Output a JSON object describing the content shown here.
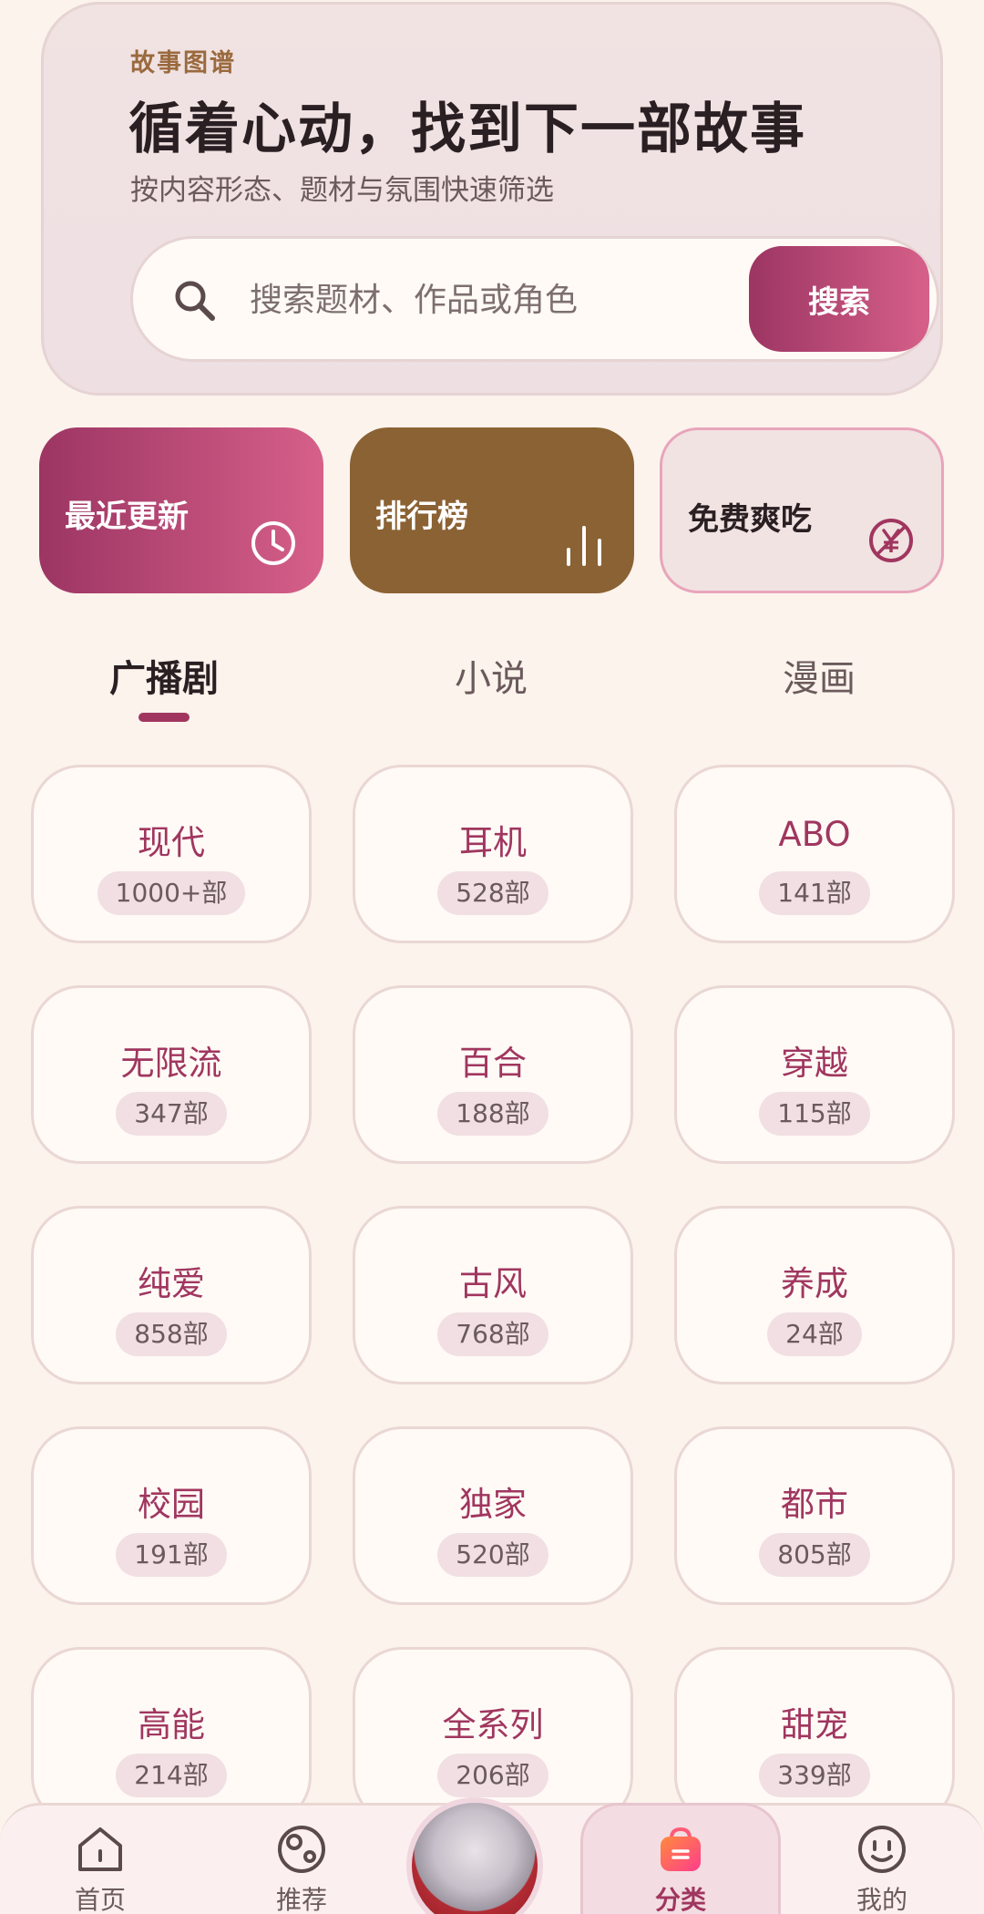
{
  "hero": {
    "kicker": "故事图谱",
    "title": "循着心动，找到下一部故事",
    "subtitle": "按内容形态、题材与氛围快速筛选"
  },
  "search": {
    "placeholder": "搜索题材、作品或角色",
    "button_label": "搜索"
  },
  "quick_tiles": [
    {
      "label": "最近更新",
      "icon": "clock-icon"
    },
    {
      "label": "排行榜",
      "icon": "bar-chart-icon"
    },
    {
      "label": "免费爽吃",
      "icon": "free-yen-icon"
    }
  ],
  "tabs": [
    {
      "label": "广播剧",
      "active": true
    },
    {
      "label": "小说",
      "active": false
    },
    {
      "label": "漫画",
      "active": false
    }
  ],
  "categories": [
    {
      "name": "现代",
      "count": "1000+部"
    },
    {
      "name": "耳机",
      "count": "528部"
    },
    {
      "name": "ABO",
      "count": "141部"
    },
    {
      "name": "无限流",
      "count": "347部"
    },
    {
      "name": "百合",
      "count": "188部"
    },
    {
      "name": "穿越",
      "count": "115部"
    },
    {
      "name": "纯爱",
      "count": "858部"
    },
    {
      "name": "古风",
      "count": "768部"
    },
    {
      "name": "养成",
      "count": "24部"
    },
    {
      "name": "校园",
      "count": "191部"
    },
    {
      "name": "独家",
      "count": "520部"
    },
    {
      "name": "都市",
      "count": "805部"
    },
    {
      "name": "高能",
      "count": "214部"
    },
    {
      "name": "全系列",
      "count": "206部"
    },
    {
      "name": "甜宠",
      "count": "339部"
    }
  ],
  "bottom_nav": [
    {
      "label": "首页",
      "icon": "home-icon"
    },
    {
      "label": "推荐",
      "icon": "recommend-icon"
    },
    {
      "label": "分类",
      "icon": "shopping-bag-icon",
      "active": true
    },
    {
      "label": "我的",
      "icon": "smiley-icon"
    }
  ],
  "colors": {
    "accent": "#a0365f",
    "accent_gradient_start": "#9c3563",
    "accent_gradient_end": "#d66089",
    "rank_tile": "#8b6234",
    "background": "#fbf3ec"
  }
}
